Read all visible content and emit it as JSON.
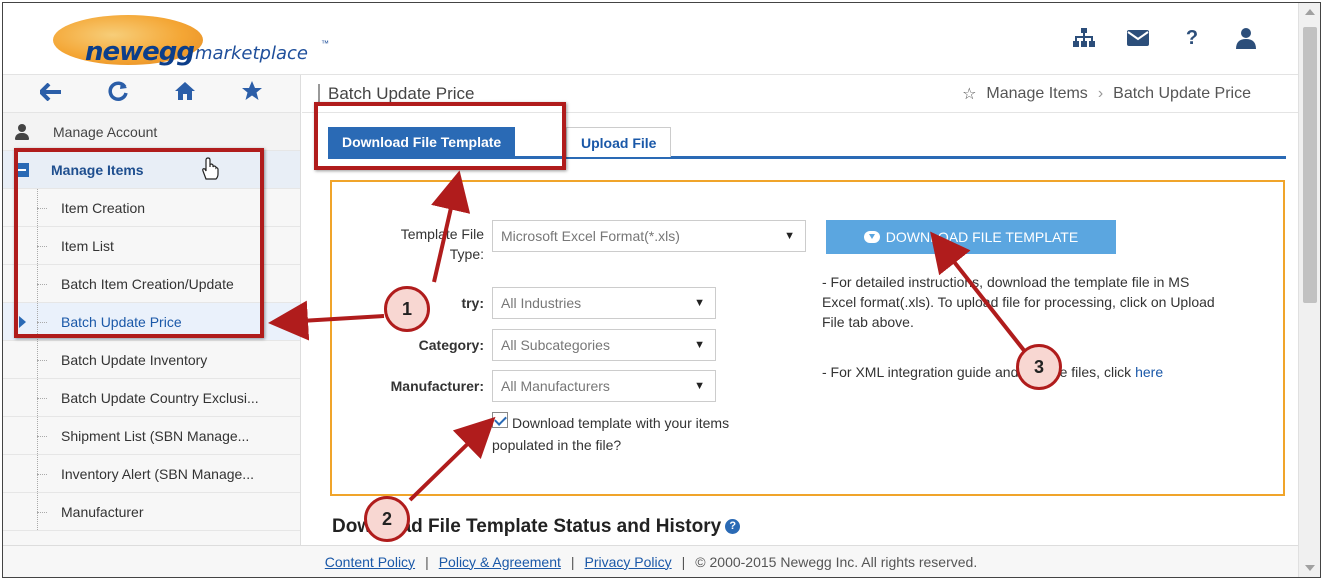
{
  "app": {
    "logo": {
      "word": "newegg",
      "market": "marketplace",
      "tm": "™"
    },
    "header_icons": [
      "sitemap-icon",
      "mail-icon",
      "help-icon",
      "user-icon"
    ]
  },
  "sidebar": {
    "tools": [
      "back-icon",
      "refresh-icon",
      "home-icon",
      "star-icon"
    ],
    "account_label": "Manage Account",
    "section_label": "Manage Items",
    "items": [
      {
        "label": "Item Creation"
      },
      {
        "label": "Item List"
      },
      {
        "label": "Batch Item Creation/Update"
      },
      {
        "label": "Batch Update Price"
      },
      {
        "label": "Batch Update Inventory"
      },
      {
        "label": "Batch Update Country Exclusi..."
      },
      {
        "label": "Shipment List (SBN Manage..."
      },
      {
        "label": "Inventory Alert (SBN Manage..."
      },
      {
        "label": "Manufacturer"
      }
    ]
  },
  "page": {
    "title": "Batch Update Price",
    "breadcrumb": {
      "parent": "Manage Items",
      "sep": "›",
      "current": "Batch Update Price"
    },
    "tabs": {
      "download": "Download File Template",
      "upload": "Upload File"
    }
  },
  "form": {
    "template_type_label_1": "Template File",
    "template_type_label_2": "Type:",
    "template_type_value": "Microsoft Excel Format(*.xls)",
    "industry_label": "try:",
    "industry_value": "All Industries",
    "category_label": "Category:",
    "category_value": "All Subcategories",
    "manufacturer_label": "Manufacturer:",
    "manufacturer_value": "All Manufacturers",
    "checkbox_label": "Download template with your items populated in the file?",
    "download_button": "DOWNLOAD FILE TEMPLATE",
    "help_1": "- For detailed instructions, download the template file in MS Excel format(.xls). To upload file for processing, click on Upload File tab above.",
    "help_2": "- For XML integration guide and sample files, click ",
    "help_link": "here"
  },
  "history": {
    "title": "Download File Template Status and History",
    "icon": "?"
  },
  "footer": {
    "content_policy": "Content Policy",
    "agreement": "Policy & Agreement",
    "privacy": "Privacy Policy",
    "copyright": "© 2000-2015 Newegg Inc. All rights reserved.",
    "sep": "|"
  },
  "annotations": {
    "c1": "1",
    "c2": "2",
    "c3": "3"
  }
}
